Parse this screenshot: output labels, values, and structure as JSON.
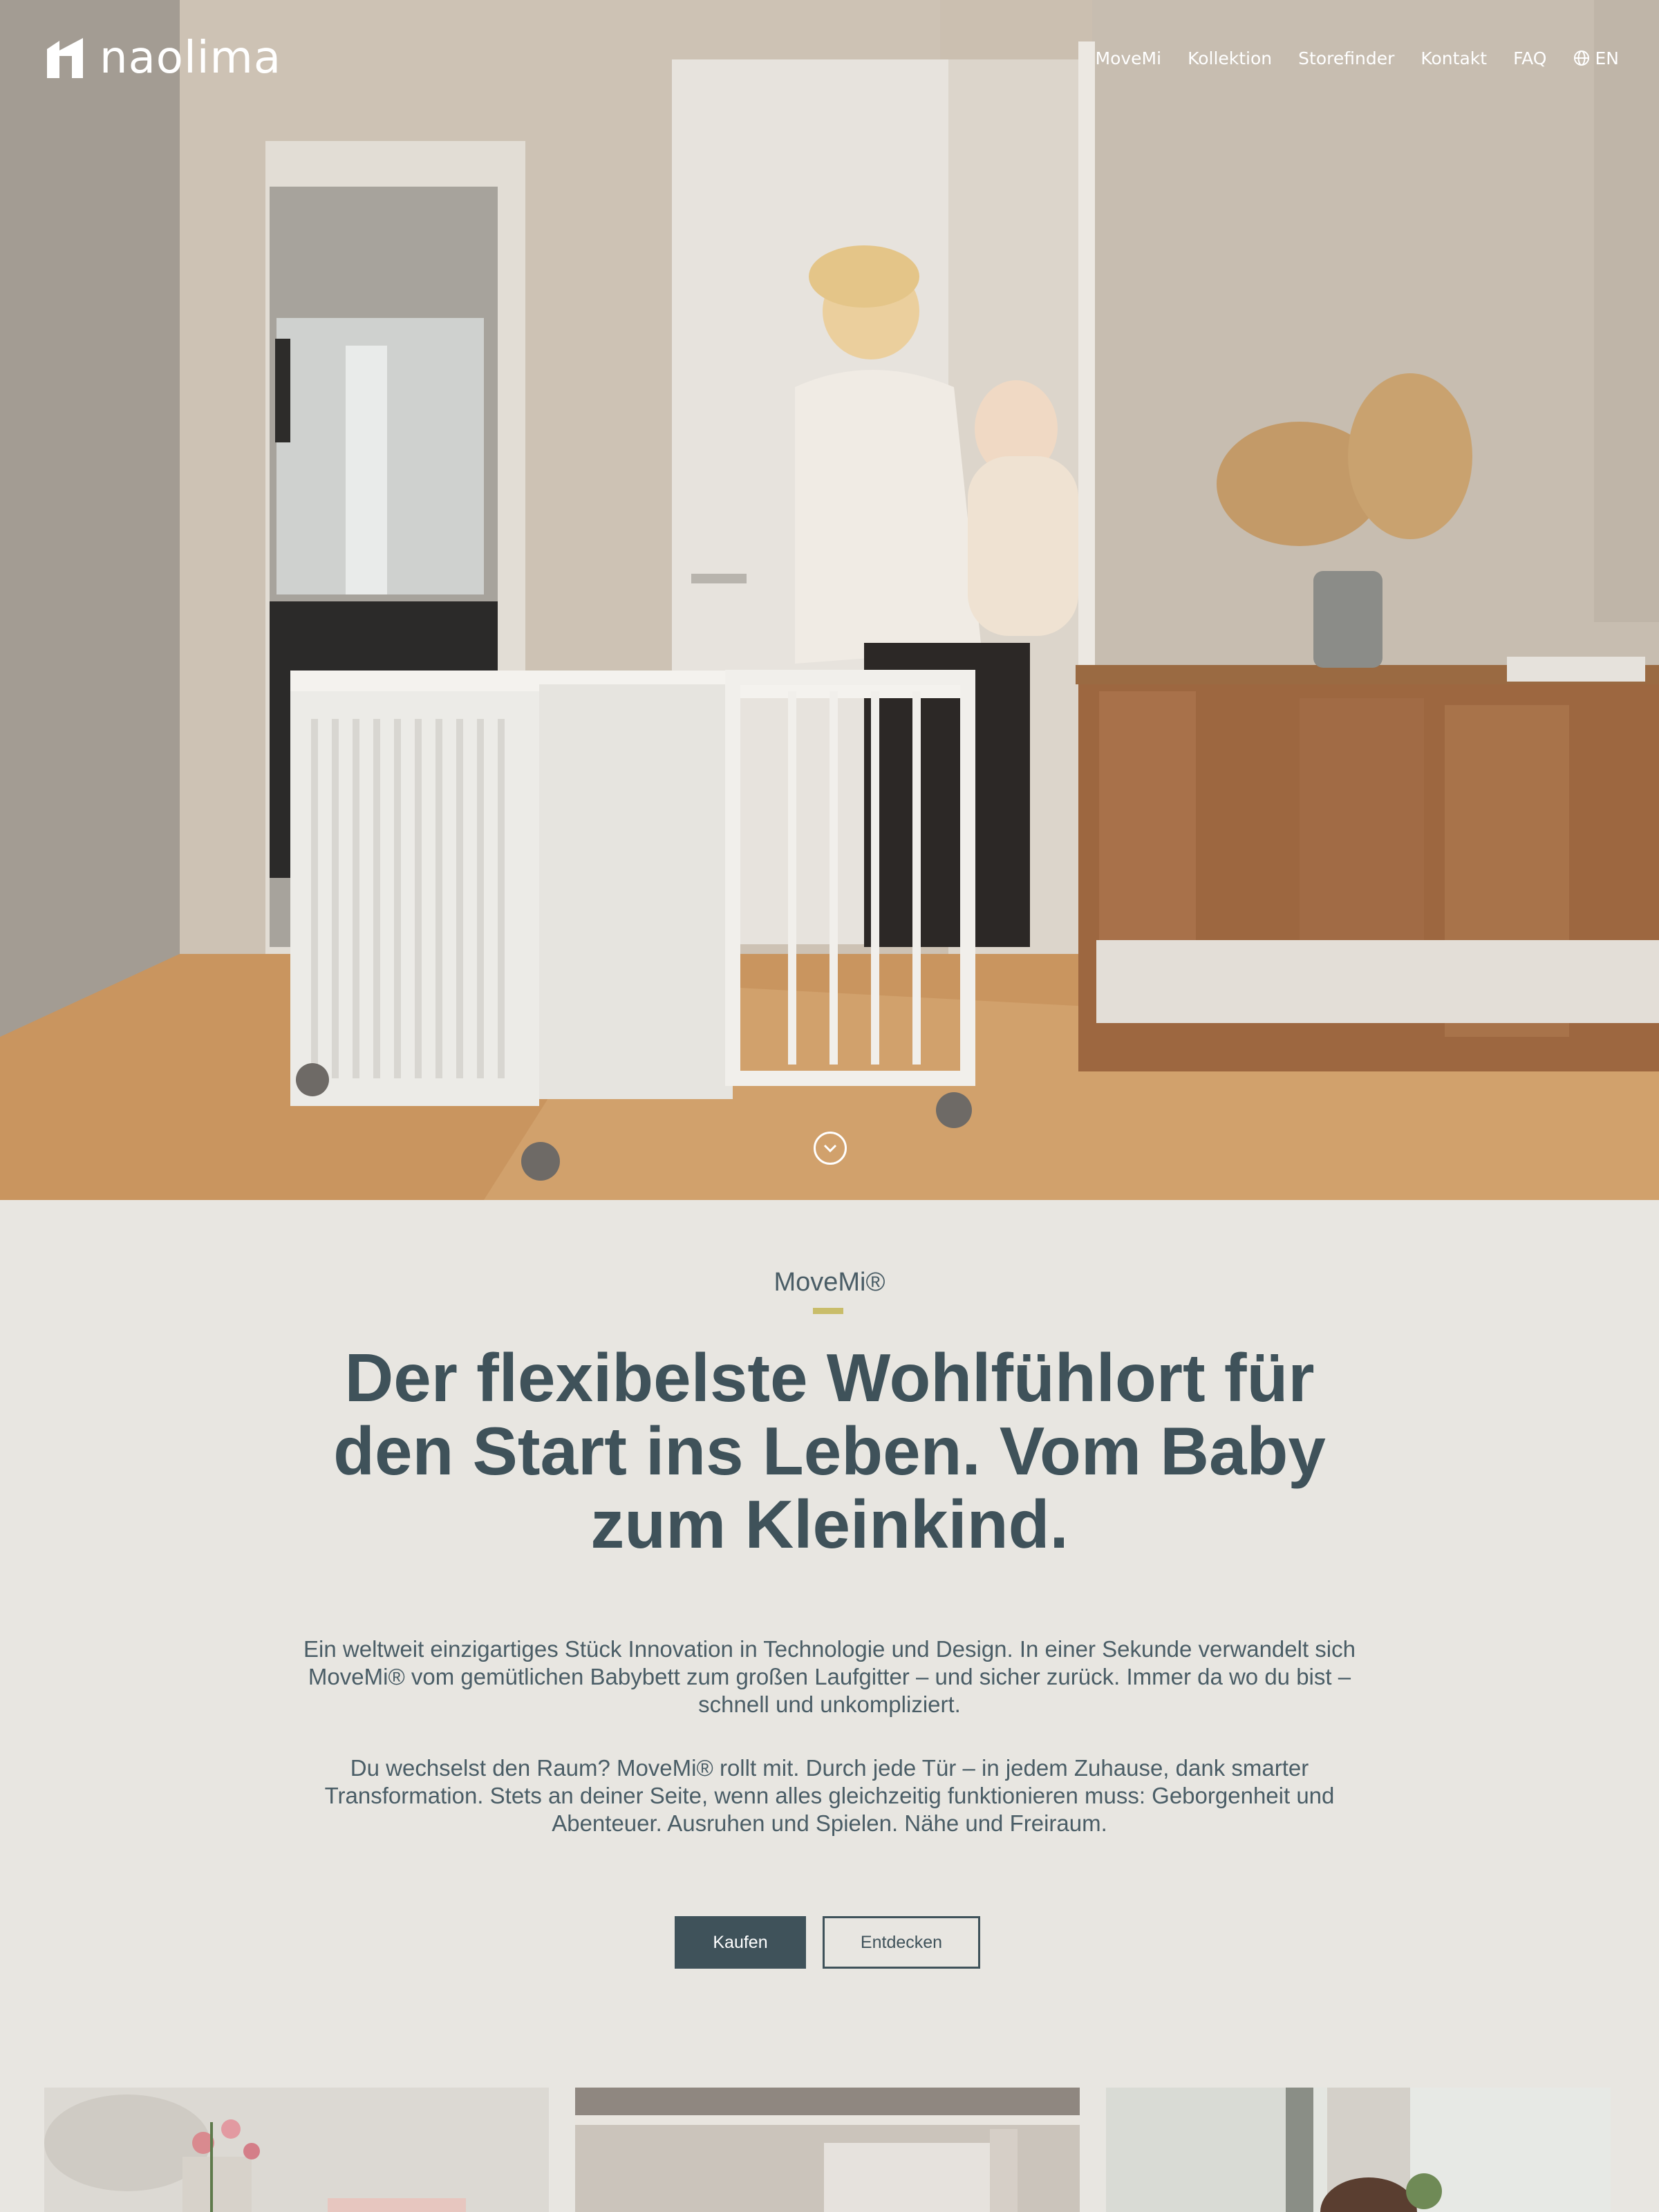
{
  "brand": {
    "name": "naolima"
  },
  "nav": {
    "items": [
      "MoveMi",
      "Kollektion",
      "Storefinder",
      "Kontakt",
      "FAQ"
    ],
    "language": "EN"
  },
  "hero": {
    "image": "mother-with-baby-and-white-movemi-crib",
    "scroll_icon": "chevron-down-icon"
  },
  "intro": {
    "eyebrow": "MoveMi®",
    "headline": "Der flexibelste Wohlfühlort für den Start ins Leben. Vom Baby zum Kleinkind.",
    "paragraph_1": "Ein weltweit einzigartiges Stück Innovation in Technologie und Design. In einer Sekunde verwandelt sich MoveMi® vom gemütlichen Babybett zum großen Laufgitter – und sicher zurück. Immer da wo du bist – schnell und unkompliziert.",
    "paragraph_2": "Du wechselst den Raum? MoveMi® rollt mit. Durch jede Tür – in jedem Zuhause, dank smarter Transformation. Stets an deiner Seite, wenn alles gleichzeitig funktionieren muss: Geborgenheit und Abenteuer. Ausruhen und Spielen. Nähe und Freiraum.",
    "buy_label": "Kaufen",
    "discover_label": "Entdecken"
  },
  "colors": {
    "background": "#e8e6e1",
    "primary": "#3f525a",
    "accent": "#c9bd6a",
    "nav_text": "#ffffff"
  }
}
